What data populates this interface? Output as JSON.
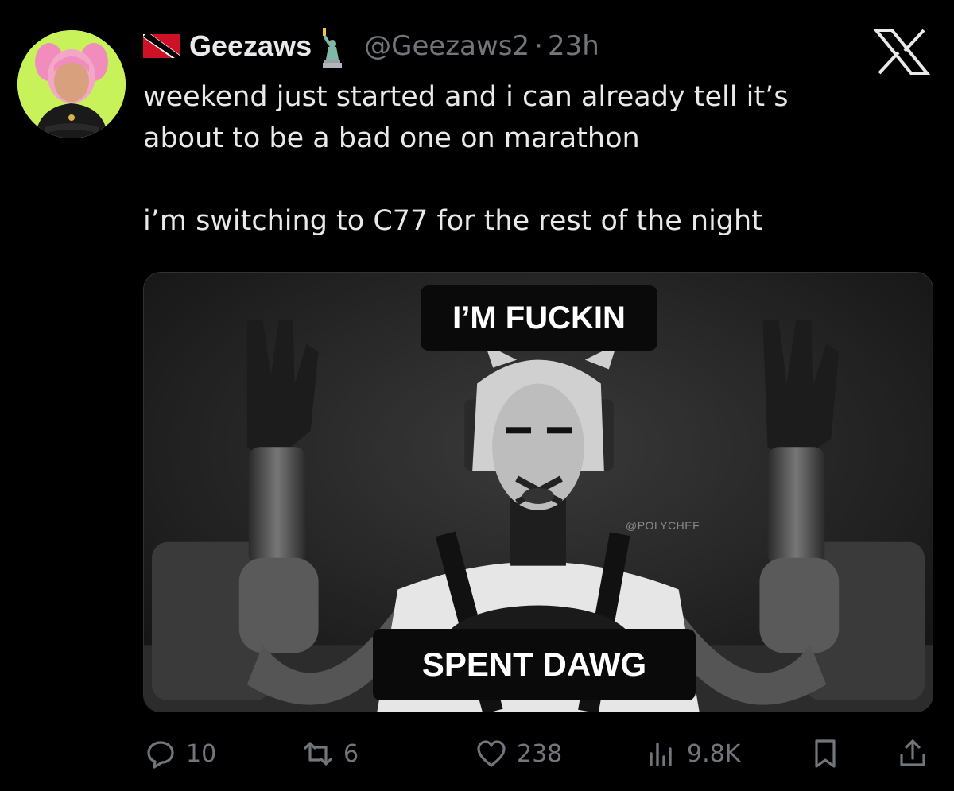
{
  "tweet": {
    "display_name": "Geezaws",
    "handle": "@Geezaws2",
    "separator": "·",
    "time": "23h",
    "text_line_1": "weekend just started and i can already tell it’s",
    "text_line_2": "about to be a bad one on marathon",
    "text_line_3": "i’m switching to C77 for the rest of the night"
  },
  "media": {
    "caption_top": "I’M FUCKIN",
    "caption_bottom": "SPENT DAWG",
    "watermark": "@POLYCHEF"
  },
  "actions": {
    "replies": "10",
    "retweets": "6",
    "likes": "238",
    "views": "9.8K"
  },
  "icons": {
    "flag": "trinidad-and-tobago-flag-icon",
    "badge": "statue-of-liberty-icon",
    "brand": "x-logo-icon",
    "reply": "reply-icon",
    "retweet": "retweet-icon",
    "like": "heart-icon",
    "views": "views-chart-icon",
    "bookmark": "bookmark-icon",
    "share": "share-icon"
  },
  "colors": {
    "background": "#000000",
    "text_primary": "#e7e9ea",
    "text_secondary": "#71767b",
    "avatar_bg": "#c7f25a"
  }
}
